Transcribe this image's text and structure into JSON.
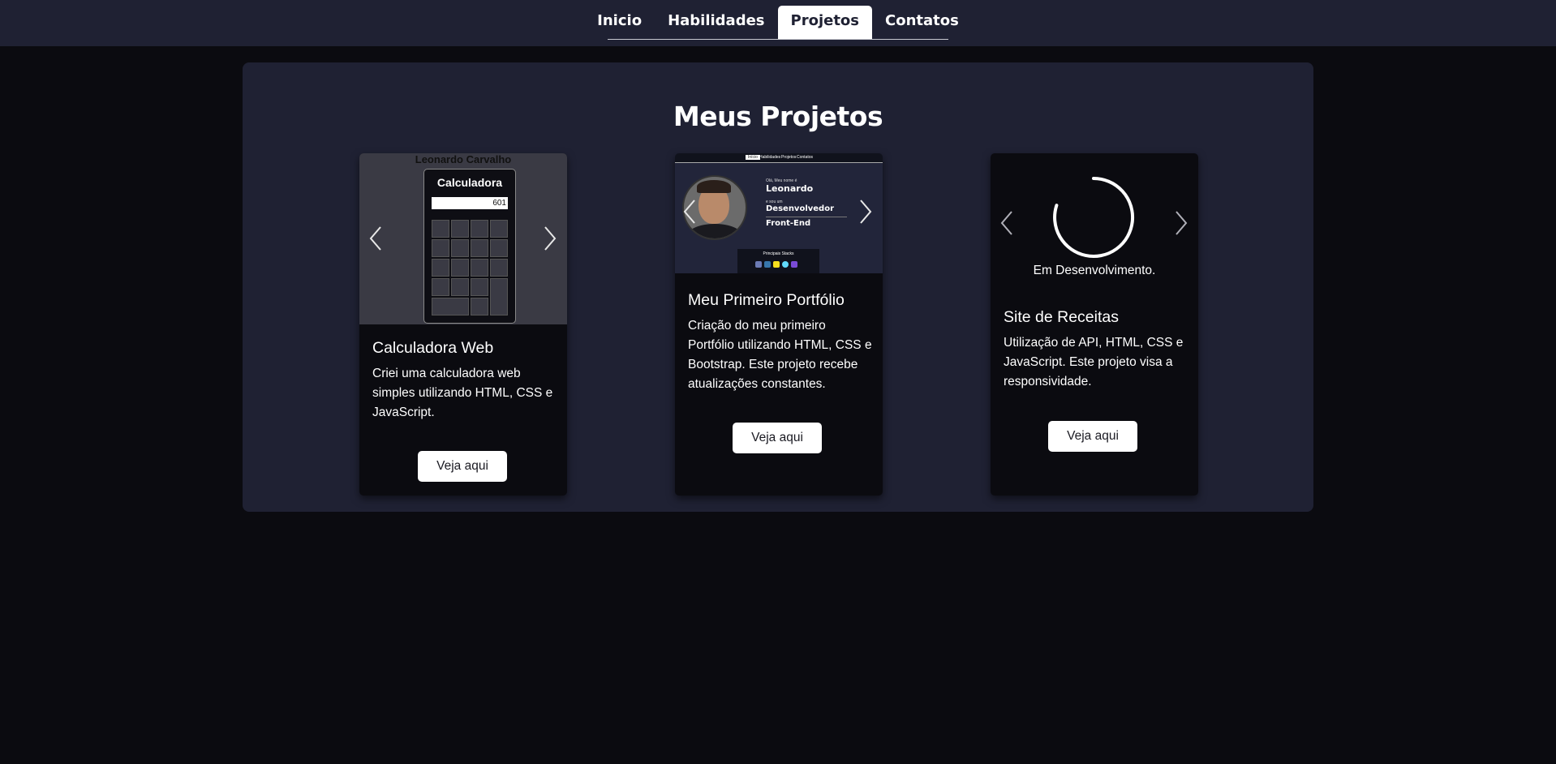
{
  "nav": {
    "tabs": [
      {
        "label": "Inicio"
      },
      {
        "label": "Habilidades"
      },
      {
        "label": "Projetos",
        "active": true
      },
      {
        "label": "Contatos"
      }
    ]
  },
  "section": {
    "title": "Meus Projetos"
  },
  "projects": [
    {
      "title": "Calculadora Web",
      "description": "Criei uma calculadora web simples utilizando HTML, CSS e JavaScript.",
      "button": "Veja aqui",
      "preview": {
        "owner": "Leonardo Carvalho",
        "heading": "Calculadora",
        "display": "601"
      }
    },
    {
      "title": "Meu Primeiro Portfólio",
      "description": "Criação do meu primeiro Portfólio utilizando HTML, CSS e Bootstrap. Este projeto recebe atualizações constantes.",
      "button": "Veja aqui",
      "preview": {
        "nav": [
          "Início",
          "Habilidades",
          "Projetos",
          "Contatos"
        ],
        "greeting": "Olá, Meu nome é",
        "name": "Leonardo",
        "role_label": "e sou um",
        "role_1": "Desenvolvedor",
        "role_2": "Front-End",
        "stacks": "Principais Stacks"
      }
    },
    {
      "title": "Site de Receitas",
      "description": "Utilização de API, HTML, CSS e JavaScript. Este projeto visa a responsividade.",
      "button": "Veja aqui",
      "preview": {
        "status": "Em Desenvolvimento."
      }
    }
  ],
  "colors": {
    "page_bg": "#0b0b10",
    "panel_bg": "#1f2133",
    "button_bg": "#ffffff"
  }
}
